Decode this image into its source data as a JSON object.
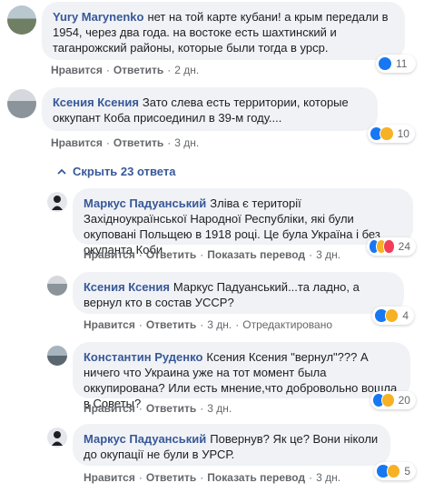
{
  "comments": [
    {
      "author": "Yury Marynenko",
      "text": "нет на той карте кубани! а крым передали в 1954, через два года. на востоке есть шахтинский и таганрожский районы, которые были тогда в урср.",
      "like": "Нравится",
      "reply": "Ответить",
      "time": "2 дн.",
      "reaction_count": "11",
      "reactions": [
        "like-icon"
      ]
    },
    {
      "author": "Ксения Ксения",
      "text": "Зато слева есть территории, которые оккупант Коба присоединил в 39-м году....",
      "like": "Нравится",
      "reply": "Ответить",
      "time": "3 дн.",
      "reaction_count": "10",
      "reactions": [
        "like-icon",
        "haha-icon"
      ]
    }
  ],
  "collapse_label": "Скрыть 23 ответа",
  "replies": [
    {
      "author": "Маркус Падуанський",
      "text": "Зліва є території Західноукраїнської Народної Республіки, які були окуповані Польщею в 1918 році. Це була Україна і без окупанта Коби.",
      "like": "Нравится",
      "reply": "Ответить",
      "extra": "Показать перевод",
      "time": "3 дн.",
      "reaction_count": "24",
      "reactions": [
        "like-icon",
        "haha-icon",
        "love-icon"
      ]
    },
    {
      "author": "Ксения Ксения",
      "text": "Маркус Падуанський...та ладно, а вернул кто в состав УССР?",
      "like": "Нравится",
      "reply": "Ответить",
      "time": "3 дн.",
      "extra": "Отредактировано",
      "reaction_count": "4",
      "reactions": [
        "like-icon",
        "haha-icon"
      ]
    },
    {
      "author": "Константин Руденко",
      "text": "Ксения Ксения \"вернул\"??? А ничего что Украина уже на тот момент была оккупирована? Или есть мнение,что добровольно вошла в Советы?",
      "like": "Нравится",
      "reply": "Ответить",
      "time": "3 дн.",
      "reaction_count": "20",
      "reactions": [
        "like-icon",
        "haha-icon"
      ]
    },
    {
      "author": "Маркус Падуанський",
      "text": "Повернув? Як це? Вони ніколи до окупації не були в УРСР.",
      "like": "Нравится",
      "reply": "Ответить",
      "extra": "Показать перевод",
      "time": "3 дн.",
      "reaction_count": "5",
      "reactions": [
        "like-icon",
        "haha-icon"
      ]
    }
  ]
}
